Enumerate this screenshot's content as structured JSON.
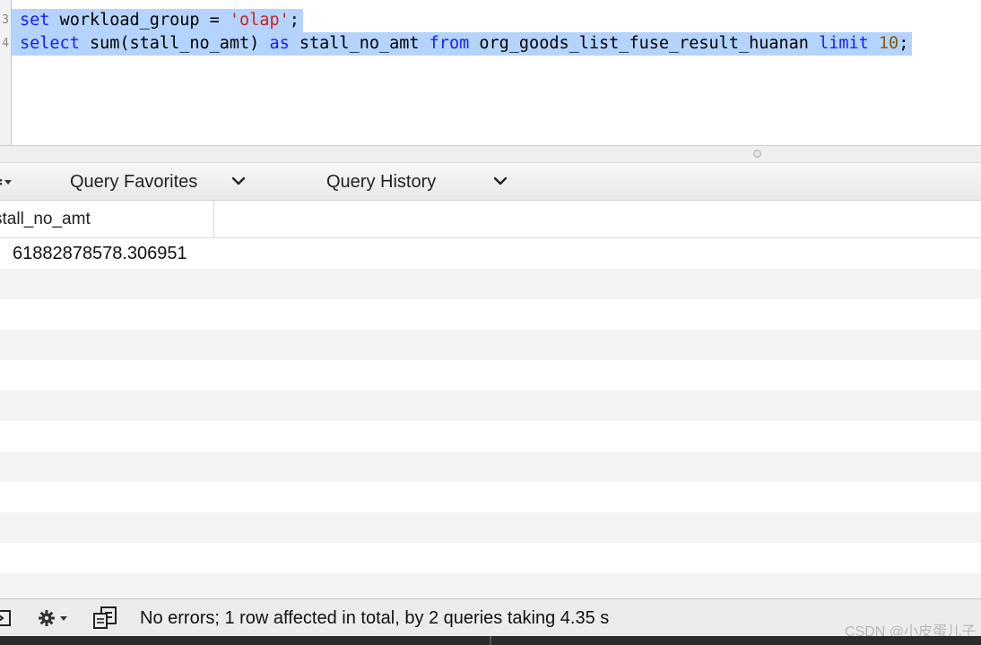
{
  "editor": {
    "lines": [
      {
        "number": "3",
        "tokens": [
          {
            "t": "set",
            "c": "kw"
          },
          {
            "t": " workload_group = ",
            "c": ""
          },
          {
            "t": "'olap'",
            "c": "str"
          },
          {
            "t": ";",
            "c": ""
          }
        ]
      },
      {
        "number": "4",
        "tokens": [
          {
            "t": "select",
            "c": "kw"
          },
          {
            "t": " sum(stall_no_amt) ",
            "c": ""
          },
          {
            "t": "as",
            "c": "kw"
          },
          {
            "t": " stall_no_amt ",
            "c": ""
          },
          {
            "t": "from",
            "c": "kw"
          },
          {
            "t": " org_goods_list_fuse_result_huanan ",
            "c": ""
          },
          {
            "t": "limit",
            "c": "kw"
          },
          {
            "t": " ",
            "c": ""
          },
          {
            "t": "10",
            "c": "num"
          },
          {
            "t": ";",
            "c": ""
          }
        ]
      }
    ],
    "selection_color": "#b4d4fd"
  },
  "tabbar": {
    "favorites_label": "Query Favorites",
    "history_label": "Query History"
  },
  "results": {
    "column_header": "stall_no_amt",
    "rows": [
      "61882878578.306951"
    ],
    "empty_row_count": 11
  },
  "status": {
    "message": "No errors; 1 row affected in total, by 2 queries taking 4.35 s"
  },
  "watermark": "CSDN @小皮蛋儿子",
  "icons": {
    "gear": "gear-icon",
    "chevron": "chevron-down-icon",
    "console": "console-icon",
    "clipboard": "clipboard-icon"
  }
}
